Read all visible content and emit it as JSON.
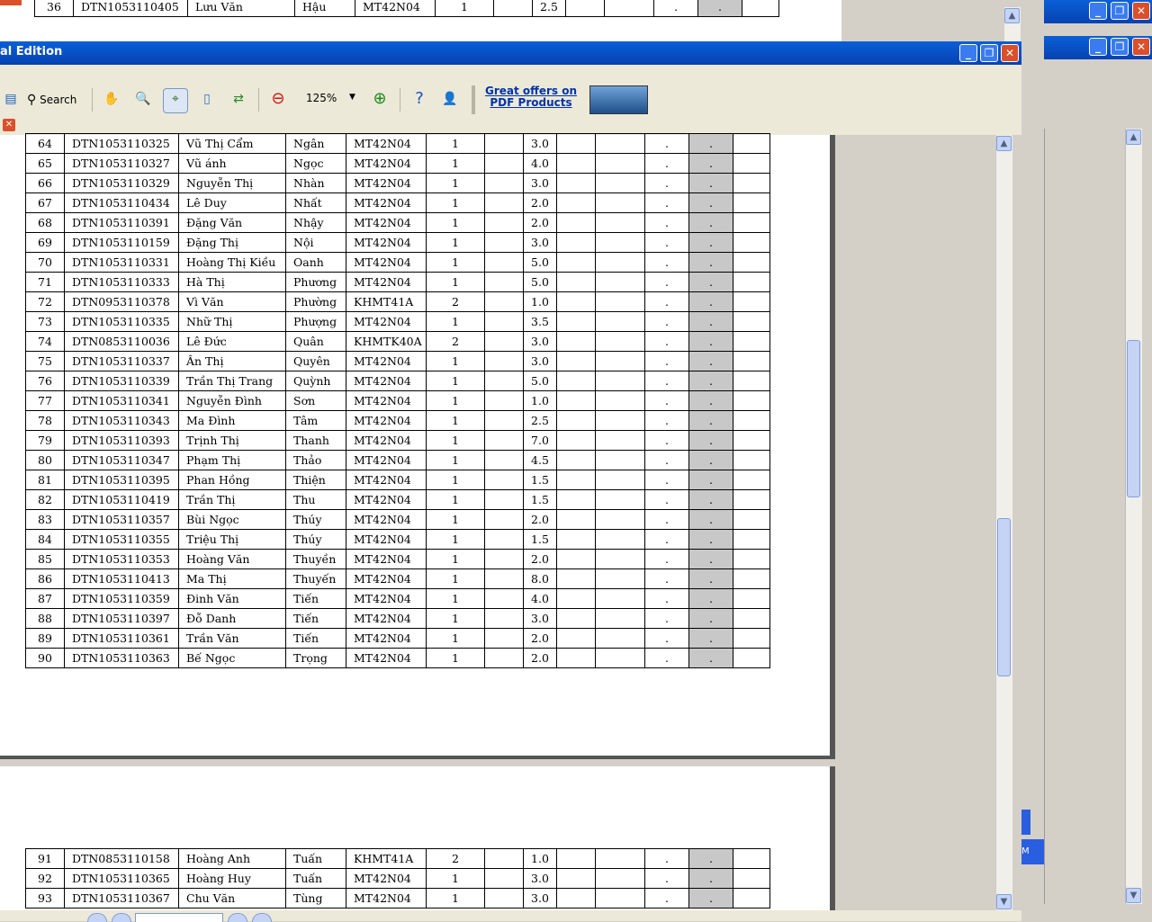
{
  "window": {
    "title": "al Edition"
  },
  "toolbar": {
    "search_label": "Search",
    "zoom_value": "125%",
    "ad_text": "Great offers on PDF Products"
  },
  "colors": {
    "titlebar": "#0a5fd8",
    "highlight_column": "#c8c8c8"
  },
  "bg_window": {
    "button_text": "M"
  },
  "top_rows": [
    [
      "36",
      "DTN1053110405",
      "Lưu Văn",
      "Hậu",
      "MT42N04",
      "1",
      "",
      "2.5",
      "",
      "",
      ".",
      ".",
      ""
    ]
  ],
  "page1_rows": [
    [
      "64",
      "DTN1053110325",
      "Vũ Thị Cẩm",
      "Ngân",
      "MT42N04",
      "1",
      "",
      "3.0",
      "",
      "",
      ".",
      ".",
      ""
    ],
    [
      "65",
      "DTN1053110327",
      "Vũ ánh",
      "Ngọc",
      "MT42N04",
      "1",
      "",
      "4.0",
      "",
      "",
      ".",
      ".",
      ""
    ],
    [
      "66",
      "DTN1053110329",
      "Nguyễn Thị",
      "Nhàn",
      "MT42N04",
      "1",
      "",
      "3.0",
      "",
      "",
      ".",
      ".",
      ""
    ],
    [
      "67",
      "DTN1053110434",
      "Lê Duy",
      "Nhất",
      "MT42N04",
      "1",
      "",
      "2.0",
      "",
      "",
      ".",
      ".",
      ""
    ],
    [
      "68",
      "DTN1053110391",
      "Đặng Văn",
      "Nhậy",
      "MT42N04",
      "1",
      "",
      "2.0",
      "",
      "",
      ".",
      ".",
      ""
    ],
    [
      "69",
      "DTN1053110159",
      "Đặng Thị",
      "Nội",
      "MT42N04",
      "1",
      "",
      "3.0",
      "",
      "",
      ".",
      ".",
      ""
    ],
    [
      "70",
      "DTN1053110331",
      "Hoàng Thị Kiều",
      "Oanh",
      "MT42N04",
      "1",
      "",
      "5.0",
      "",
      "",
      ".",
      ".",
      ""
    ],
    [
      "71",
      "DTN1053110333",
      "Hà Thị",
      "Phương",
      "MT42N04",
      "1",
      "",
      "5.0",
      "",
      "",
      ".",
      ".",
      ""
    ],
    [
      "72",
      "DTN0953110378",
      "Vì Văn",
      "Phường",
      "KHMT41A",
      "2",
      "",
      "1.0",
      "",
      "",
      ".",
      ".",
      ""
    ],
    [
      "73",
      "DTN1053110335",
      "Nhữ Thị",
      "Phượng",
      "MT42N04",
      "1",
      "",
      "3.5",
      "",
      "",
      ".",
      ".",
      ""
    ],
    [
      "74",
      "DTN0853110036",
      "Lê Đức",
      "Quân",
      "KHMTK40A",
      "2",
      "",
      "3.0",
      "",
      "",
      ".",
      ".",
      ""
    ],
    [
      "75",
      "DTN1053110337",
      "Ân Thị",
      "Quyên",
      "MT42N04",
      "1",
      "",
      "3.0",
      "",
      "",
      ".",
      ".",
      ""
    ],
    [
      "76",
      "DTN1053110339",
      "Trần Thị Trang",
      "Quỳnh",
      "MT42N04",
      "1",
      "",
      "5.0",
      "",
      "",
      ".",
      ".",
      ""
    ],
    [
      "77",
      "DTN1053110341",
      "Nguyễn Đình",
      "Sơn",
      "MT42N04",
      "1",
      "",
      "1.0",
      "",
      "",
      ".",
      ".",
      ""
    ],
    [
      "78",
      "DTN1053110343",
      "Ma Đình",
      "Tâm",
      "MT42N04",
      "1",
      "",
      "2.5",
      "",
      "",
      ".",
      ".",
      ""
    ],
    [
      "79",
      "DTN1053110393",
      "Trịnh Thị",
      "Thanh",
      "MT42N04",
      "1",
      "",
      "7.0",
      "",
      "",
      ".",
      ".",
      ""
    ],
    [
      "80",
      "DTN1053110347",
      "Phạm Thị",
      "Thảo",
      "MT42N04",
      "1",
      "",
      "4.5",
      "",
      "",
      ".",
      ".",
      ""
    ],
    [
      "81",
      "DTN1053110395",
      "Phan Hồng",
      "Thiện",
      "MT42N04",
      "1",
      "",
      "1.5",
      "",
      "",
      ".",
      ".",
      ""
    ],
    [
      "82",
      "DTN1053110419",
      "Trần Thị",
      "Thu",
      "MT42N04",
      "1",
      "",
      "1.5",
      "",
      "",
      ".",
      ".",
      ""
    ],
    [
      "83",
      "DTN1053110357",
      "Bùi Ngọc",
      "Thúy",
      "MT42N04",
      "1",
      "",
      "2.0",
      "",
      "",
      ".",
      ".",
      ""
    ],
    [
      "84",
      "DTN1053110355",
      "Triệu Thị",
      "Thúy",
      "MT42N04",
      "1",
      "",
      "1.5",
      "",
      "",
      ".",
      ".",
      ""
    ],
    [
      "85",
      "DTN1053110353",
      "Hoàng Văn",
      "Thuyền",
      "MT42N04",
      "1",
      "",
      "2.0",
      "",
      "",
      ".",
      ".",
      ""
    ],
    [
      "86",
      "DTN1053110413",
      "Ma Thị",
      "Thuyến",
      "MT42N04",
      "1",
      "",
      "8.0",
      "",
      "",
      ".",
      ".",
      ""
    ],
    [
      "87",
      "DTN1053110359",
      "Đinh Văn",
      "Tiến",
      "MT42N04",
      "1",
      "",
      "4.0",
      "",
      "",
      ".",
      ".",
      ""
    ],
    [
      "88",
      "DTN1053110397",
      "Đỗ Danh",
      "Tiến",
      "MT42N04",
      "1",
      "",
      "3.0",
      "",
      "",
      ".",
      ".",
      ""
    ],
    [
      "89",
      "DTN1053110361",
      "Trần Văn",
      "Tiến",
      "MT42N04",
      "1",
      "",
      "2.0",
      "",
      "",
      ".",
      ".",
      ""
    ],
    [
      "90",
      "DTN1053110363",
      "Bế Ngọc",
      "Trọng",
      "MT42N04",
      "1",
      "",
      "2.0",
      "",
      "",
      ".",
      ".",
      ""
    ]
  ],
  "page2_rows": [
    [
      "91",
      "DTN0853110158",
      "Hoàng Anh",
      "Tuấn",
      "KHMT41A",
      "2",
      "",
      "1.0",
      "",
      "",
      ".",
      ".",
      ""
    ],
    [
      "92",
      "DTN1053110365",
      "Hoàng Huy",
      "Tuấn",
      "MT42N04",
      "1",
      "",
      "3.0",
      "",
      "",
      ".",
      ".",
      ""
    ],
    [
      "93",
      "DTN1053110367",
      "Chu Văn",
      "Tùng",
      "MT42N04",
      "1",
      "",
      "3.0",
      "",
      "",
      ".",
      ".",
      ""
    ]
  ]
}
